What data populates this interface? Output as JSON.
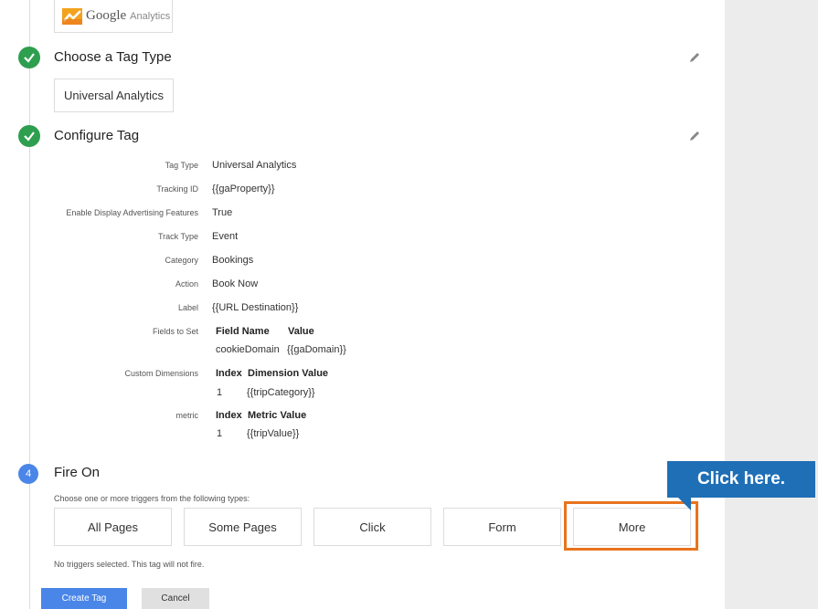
{
  "ga_box": {
    "brand": "Google",
    "product": "Analytics"
  },
  "steps": {
    "tag_type": {
      "title": "Choose a Tag Type",
      "selected": "Universal Analytics"
    },
    "configure": {
      "title": "Configure Tag"
    },
    "fire_on": {
      "number": "4",
      "title": "Fire On",
      "description": "Choose one or more triggers from the following types:",
      "no_triggers": "No triggers selected. This tag will not fire."
    }
  },
  "config": {
    "tag_type": {
      "label": "Tag Type",
      "value": "Universal Analytics"
    },
    "tracking_id": {
      "label": "Tracking ID",
      "value": "{{gaProperty}}"
    },
    "display_adv": {
      "label": "Enable Display Advertising Features",
      "value": "True"
    },
    "track_type": {
      "label": "Track Type",
      "value": "Event"
    },
    "category": {
      "label": "Category",
      "value": "Bookings"
    },
    "action": {
      "label": "Action",
      "value": "Book Now"
    },
    "label": {
      "label": "Label",
      "value": "{{URL Destination}}"
    },
    "fields_to_set": {
      "label": "Fields to Set",
      "col1": "Field Name",
      "col2": "Value",
      "row_name": "cookieDomain",
      "row_value": "{{gaDomain}}"
    },
    "custom_dimensions": {
      "label": "Custom Dimensions",
      "col1": "Index",
      "col2": "Dimension Value",
      "row_index": "1",
      "row_value": "{{tripCategory}}"
    },
    "metric": {
      "label": "metric",
      "col1": "Index",
      "col2": "Metric Value",
      "row_index": "1",
      "row_value": "{{tripValue}}"
    }
  },
  "triggers": [
    "All Pages",
    "Some Pages",
    "Click",
    "Form",
    "More"
  ],
  "callout": "Click here.",
  "buttons": {
    "create": "Create Tag",
    "cancel": "Cancel"
  },
  "colors": {
    "accent_blue": "#4a86e8",
    "check_green": "#2e9e4f",
    "highlight_orange": "#e8731d",
    "callout_blue": "#1f6fb6"
  }
}
